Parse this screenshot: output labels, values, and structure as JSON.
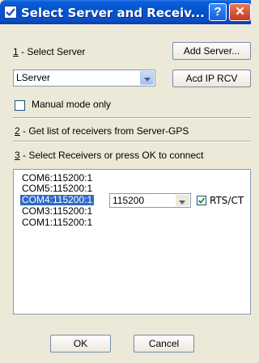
{
  "window": {
    "title": "Select Server and Receiv...",
    "help_label": "?",
    "close_label": "✕"
  },
  "step1": {
    "num": "1",
    "label": " - Select Server",
    "add_server_label": "Add Server...",
    "server_value": "LServer",
    "add_ip_label": "Acd IP RCV",
    "manual_mode_label": "Manual mode only",
    "manual_mode_checked": false
  },
  "step2": {
    "num": "2",
    "label": " - Get list of receivers from Server-GPS"
  },
  "step3": {
    "num": "3",
    "label": " - Select Receivers or press OK to connect"
  },
  "receivers": [
    "COM6:115200:1",
    "COM5:115200:1",
    "COM4:115200:1",
    "COM3:115200:1",
    "COM1:115200:1"
  ],
  "selected_receiver_index": 2,
  "baud_value": "115200",
  "rts_label": "RTS/CT",
  "rts_checked": true,
  "buttons": {
    "ok_label": "OK",
    "cancel_label": "Cancel"
  }
}
